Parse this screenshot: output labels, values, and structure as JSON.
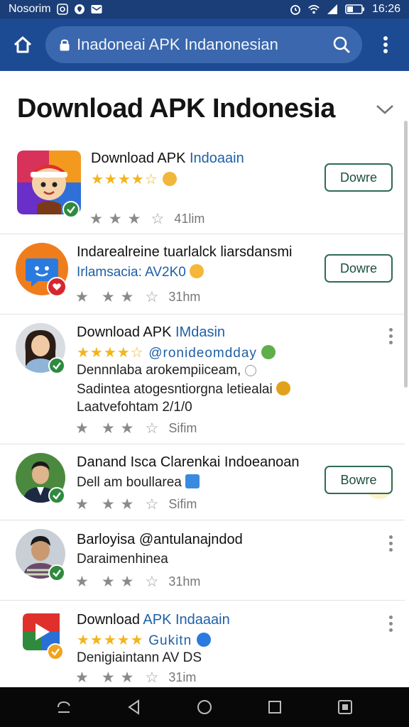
{
  "status_bar": {
    "carrier": "Nosorim",
    "time": "16:26"
  },
  "browser": {
    "url": "Inadoneai APK Indanonesian"
  },
  "page": {
    "title": "Download APK Indonesia"
  },
  "colors": {
    "status_bar": "#1b3e78",
    "toolbar": "#1d4b93",
    "url_pill": "#3a67ad",
    "accent_green": "#2e6b55",
    "link_blue": "#1f5fa6",
    "star_gold": "#f2b51c",
    "badge_green": "#2e8a3e"
  },
  "items": [
    {
      "title_a": "Download APK ",
      "title_b": "Indoaain",
      "line2_stars": "★★★★☆",
      "rating_count": "41lim",
      "button": "Dowre",
      "icon": "character-app-icon"
    },
    {
      "title": "Indarealreine tuarlalck liarsdansmi",
      "line2": "Irlamsacia: AV2K0",
      "rating_count": "31hm",
      "button": "Dowre",
      "icon": "chat-app-icon"
    },
    {
      "title_a": "Download APK ",
      "title_b": "IMdasin",
      "line2_stars": "★★★★☆",
      "line2_handle": "@ronideomdday",
      "line3": "Dennnlaba arokempiiceam,",
      "line4": "Sadintea  atogesntiorgna letiealai",
      "line5": "Laatvefohtam 2/1/0",
      "rating_count": "Sifim",
      "icon": "woman-avatar"
    },
    {
      "title": "Danand Isca Clarenkai Indoeanoan",
      "line2": "Dell am boullarea",
      "rating_count": "Sifim",
      "button": "Bowre",
      "icon": "man-avatar"
    },
    {
      "title": "Barloyisa @antulanajndod",
      "line2": "Daraimenhinea",
      "rating_count": "31hm",
      "icon": "young-man-avatar"
    },
    {
      "title_a": "Download ",
      "title_b": "APK Indaaain",
      "line2_stars": "★★★★★",
      "line2_extra": "Gukitn",
      "line3": "Denigiaintann AV DS",
      "rating_count": "31im",
      "icon": "play-app-icon"
    }
  ]
}
